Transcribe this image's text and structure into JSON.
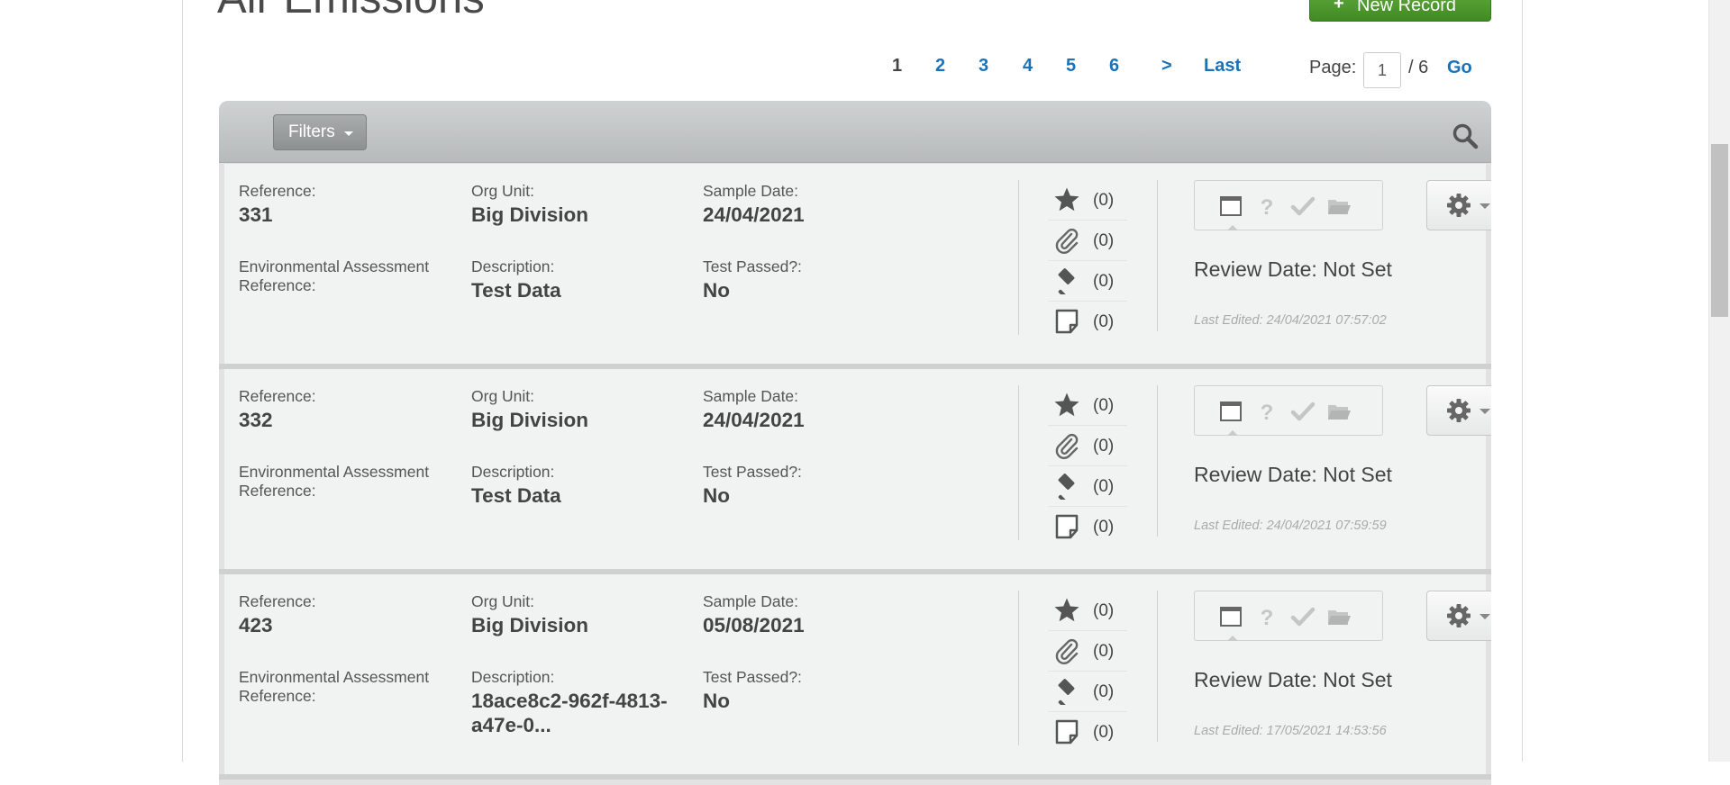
{
  "header": {
    "title": "Air Emissions",
    "new_record_label": "New Record",
    "new_record_icon": "plus-icon",
    "brand_green": "#4a9a2c"
  },
  "pagination": {
    "current": "1",
    "pages": [
      "2",
      "3",
      "4",
      "5",
      "6"
    ],
    "next_label": ">",
    "last_label": "Last",
    "page_label": "Page:",
    "page_input_value": "1",
    "total_label": "/ 6",
    "go_label": "Go",
    "link_color": "#1a73b8"
  },
  "toolbar": {
    "filters_label": "Filters",
    "search_icon": "search-icon"
  },
  "labels": {
    "reference": "Reference:",
    "org_unit": "Org Unit:",
    "sample_date": "Sample Date:",
    "env_ref": "Environmental Assessment Reference:",
    "description": "Description:",
    "test_passed": "Test Passed?:"
  },
  "records": [
    {
      "reference": "331",
      "org_unit": "Big Division",
      "sample_date": "24/04/2021",
      "env_ref": "",
      "description": "Test Data",
      "test_passed": "No",
      "counts": [
        "(0)",
        "(0)",
        "(0)",
        "(0)"
      ],
      "review": "Review Date: Not Set",
      "last_edited": "Last Edited: 24/04/2021 07:57:02"
    },
    {
      "reference": "332",
      "org_unit": "Big Division",
      "sample_date": "24/04/2021",
      "env_ref": "",
      "description": "Test Data",
      "test_passed": "No",
      "counts": [
        "(0)",
        "(0)",
        "(0)",
        "(0)"
      ],
      "review": "Review Date: Not Set",
      "last_edited": "Last Edited: 24/04/2021 07:59:59"
    },
    {
      "reference": "423",
      "org_unit": "Big Division",
      "sample_date": "05/08/2021",
      "env_ref": "",
      "description": "18ace8c2-962f-4813-a47e-0...",
      "test_passed": "No",
      "counts": [
        "(0)",
        "(0)",
        "(0)",
        "(0)"
      ],
      "review": "Review Date: Not Set",
      "last_edited": "Last Edited: 17/05/2021 14:53:56"
    }
  ],
  "count_icons": [
    "star-icon",
    "paperclip-icon",
    "gavel-icon",
    "note-icon"
  ],
  "tab_icons": [
    "window-icon",
    "question-icon",
    "check-icon",
    "folder-icon"
  ],
  "action_icon": "gear-icon"
}
